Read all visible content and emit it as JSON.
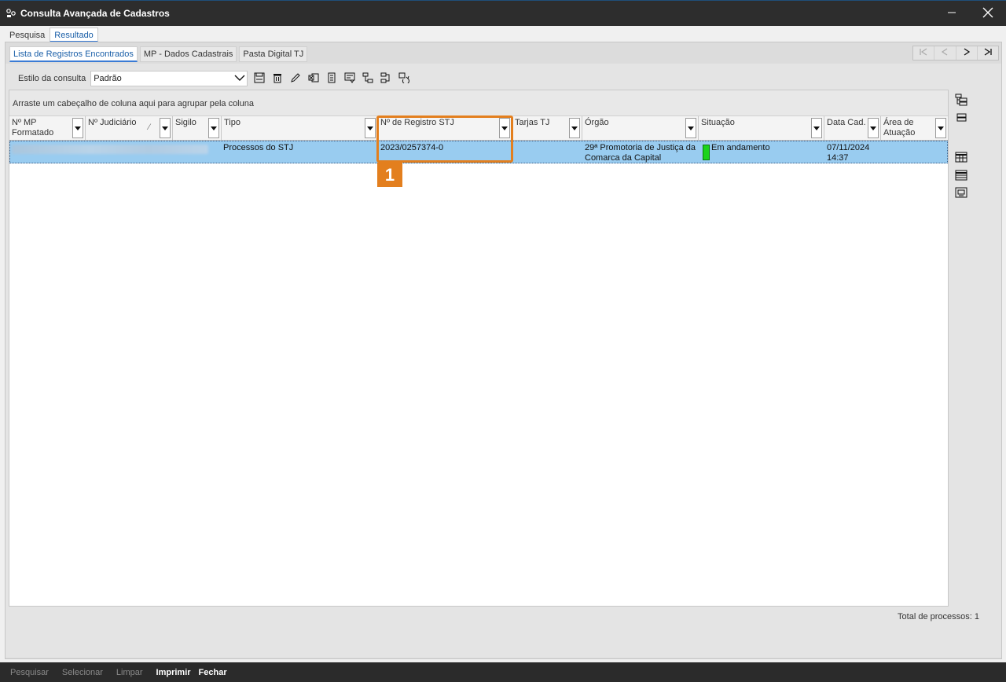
{
  "window": {
    "title": "Consulta Avançada de Cadastros",
    "icons": {
      "app": "app-logo-icon",
      "minimize": "minimize-icon",
      "close": "close-icon"
    }
  },
  "top_tabs": [
    {
      "label": "Pesquisa",
      "active": false
    },
    {
      "label": "Resultado",
      "active": true
    }
  ],
  "sub_tabs": [
    {
      "label": "Lista de Registros Encontrados",
      "active": true
    },
    {
      "label": "MP - Dados Cadastrais",
      "active": false
    },
    {
      "label": "Pasta Digital TJ",
      "active": false
    }
  ],
  "toolbar": {
    "label": "Estilo da consulta",
    "style_value": "Padrão",
    "icons": [
      "save-icon",
      "delete-icon",
      "edit-icon",
      "export-excel-icon",
      "document-icon",
      "report-icon",
      "tree-report-icon",
      "tree-export-icon",
      "refresh-icon"
    ]
  },
  "grid": {
    "group_hint": "Arraste um cabeçalho de coluna aqui para agrupar pela coluna",
    "columns": [
      "Nº MP Formatado",
      "Nº Judiciário",
      "Sigilo",
      "Tipo",
      "Nº de Registro STJ",
      "Tarjas TJ",
      "Órgão",
      "Situação",
      "Data Cad.",
      "Área de Atuação"
    ],
    "rows": [
      {
        "tipo": "Processos do STJ",
        "registro_stj": "2023/0257374-0",
        "orgao": "29ª Promotoria de Justiça da Comarca da Capital",
        "situacao": "Em andamento",
        "situacao_color": "#1bd31b",
        "data_cad": "07/11/2024 14:37"
      }
    ]
  },
  "annotation": {
    "label": "1",
    "color": "#e37f1e"
  },
  "side_icons": [
    "group-tree-icon",
    "collapse-icon",
    "table-grid-icon",
    "list-view-icon",
    "print-preview-icon"
  ],
  "total": "Total de processos: 1",
  "bottom_buttons": [
    {
      "label": "Pesquisar",
      "enabled": false
    },
    {
      "label": "Selecionar",
      "enabled": false
    },
    {
      "label": "Limpar",
      "enabled": false
    },
    {
      "label": "Imprimir",
      "enabled": true
    },
    {
      "label": "Fechar",
      "enabled": true
    }
  ]
}
